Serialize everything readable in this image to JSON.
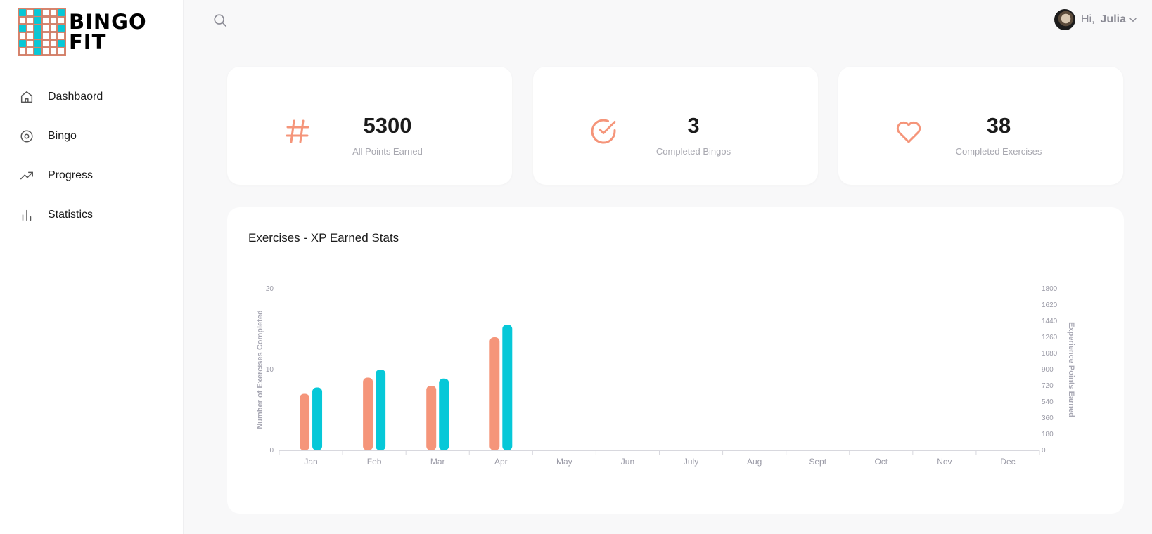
{
  "app": {
    "logo_text_line1": "BINGO",
    "logo_text_line2": "FIT"
  },
  "sidebar": {
    "items": [
      {
        "label": "Dashbaord",
        "icon": "home-icon"
      },
      {
        "label": "Bingo",
        "icon": "target-icon"
      },
      {
        "label": "Progress",
        "icon": "trending-up-icon"
      },
      {
        "label": "Statistics",
        "icon": "bar-chart-icon"
      }
    ]
  },
  "header": {
    "search_icon": "search-icon",
    "greeting": "Hi,",
    "user_name": "Julia"
  },
  "stats": [
    {
      "value": "5300",
      "label": "All Points Earned",
      "icon": "hash-icon"
    },
    {
      "value": "3",
      "label": "Completed Bingos",
      "icon": "check-circle-icon"
    },
    {
      "value": "38",
      "label": "Completed Exercises",
      "icon": "heart-icon"
    }
  ],
  "colors": {
    "accent_salmon": "#f5957a",
    "accent_cyan": "#06c8d8"
  },
  "chart_data": {
    "type": "bar",
    "title": "Exercises - XP Earned Stats",
    "categories": [
      "Jan",
      "Feb",
      "Mar",
      "Apr",
      "May",
      "Jun",
      "July",
      "Aug",
      "Sept",
      "Oct",
      "Nov",
      "Dec"
    ],
    "series": [
      {
        "axis": "left",
        "color": "#f5957a",
        "values": [
          7,
          9,
          8,
          14,
          null,
          null,
          null,
          null,
          null,
          null,
          null,
          null
        ]
      },
      {
        "axis": "right",
        "color": "#06c8d8",
        "values": [
          700,
          900,
          800,
          1400,
          null,
          null,
          null,
          null,
          null,
          null,
          null,
          null
        ]
      }
    ],
    "ylabel_left": "Number of Exercises Completed",
    "ylabel_right": "Experience Points Earned",
    "ylim_left": [
      0,
      20
    ],
    "ylim_right": [
      0,
      1800
    ],
    "yticks_left": [
      "0",
      "10",
      "20"
    ],
    "yticks_right": [
      "0",
      "180",
      "360",
      "540",
      "720",
      "900",
      "1080",
      "1260",
      "1440",
      "1620",
      "1800"
    ],
    "grid": false,
    "legend": "none"
  }
}
